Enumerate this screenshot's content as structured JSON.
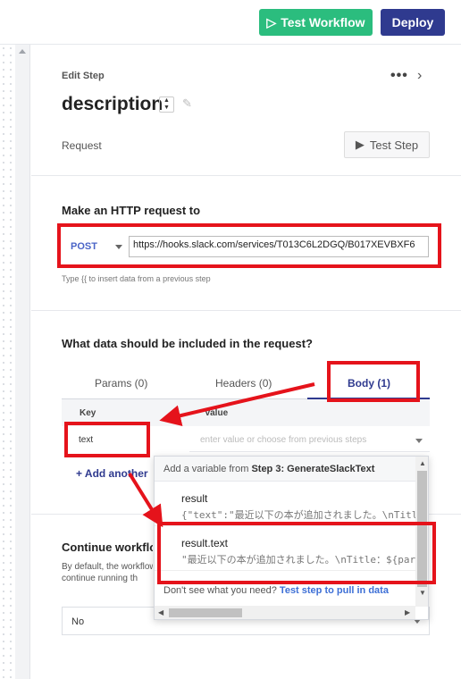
{
  "topbar": {
    "test_workflow_label": "Test Workflow",
    "deploy_label": "Deploy"
  },
  "step": {
    "section_label": "Edit Step",
    "title": "description",
    "request_label": "Request",
    "test_step_label": "Test Step"
  },
  "http": {
    "heading": "Make an HTTP request to",
    "method": "POST",
    "url": "https://hooks.slack.com/services/T013C6L2DGQ/B017XEVBXF6",
    "hint": "Type {{ to insert data from a previous step"
  },
  "body_section": {
    "heading": "What data should be included in the request?",
    "tabs": [
      {
        "label": "Params (0)"
      },
      {
        "label": "Headers (0)"
      },
      {
        "label": "Body (1)"
      }
    ],
    "columns": {
      "key": "Key",
      "value": "Value"
    },
    "row": {
      "key": "text",
      "value_placeholder": "enter value or choose from previous steps"
    },
    "add_label": "+ Add another"
  },
  "continue": {
    "heading": "Continue workflow",
    "desc_line1": "By default, the workflow",
    "desc_line2": "continue running th",
    "select_value": "No"
  },
  "popup": {
    "head_prefix": "Add a variable from ",
    "head_step": "Step 3: GenerateSlackText",
    "options": [
      {
        "name": "result",
        "value": "{\"text\":\"最近以下の本が追加されました。\\nTitle"
      },
      {
        "name": "result.text",
        "value": "\"最近以下の本が追加されました。\\nTitle：${par"
      }
    ],
    "foot_text": "Don't see what you need?",
    "foot_link": "Test step to pull in data"
  },
  "colors": {
    "accent_green": "#2bbd7e",
    "accent_navy": "#2f3a8f",
    "annotation_red": "#e5131b"
  }
}
